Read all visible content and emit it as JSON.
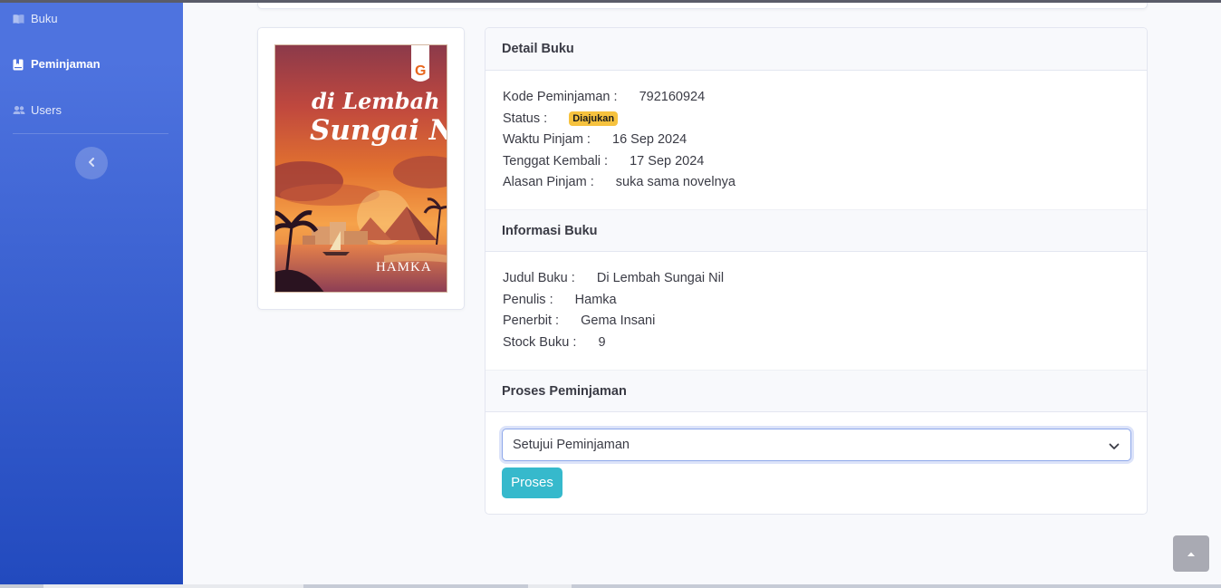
{
  "sidebar": {
    "items": [
      {
        "label": "Buku",
        "icon": "book-icon",
        "active": false
      },
      {
        "label": "Peminjaman",
        "icon": "bookmark-icon",
        "active": true
      },
      {
        "label": "Users",
        "icon": "users-icon",
        "active": false
      }
    ],
    "toggle_icon": "chevron-left-icon"
  },
  "book": {
    "cover": {
      "title_line1": "di Lembah",
      "title_line2": "Sungai Nil",
      "author": "HAMKA",
      "publisher_logo": "G"
    }
  },
  "detail": {
    "header": "Detail Buku",
    "kode_label": "Kode Peminjaman :",
    "kode_value": "792160924",
    "status_label": "Status :",
    "status_value": "Diajukan",
    "waktu_label": "Waktu Pinjam :",
    "waktu_value": "16 Sep 2024",
    "tenggat_label": "Tenggat Kembali :",
    "tenggat_value": "17 Sep 2024",
    "alasan_label": "Alasan Pinjam :",
    "alasan_value": "suka sama novelnya"
  },
  "info": {
    "header": "Informasi Buku",
    "judul_label": "Judul Buku :",
    "judul_value": "Di Lembah Sungai Nil",
    "penulis_label": "Penulis :",
    "penulis_value": "Hamka",
    "penerbit_label": "Penerbit :",
    "penerbit_value": "Gema Insani",
    "stock_label": "Stock Buku :",
    "stock_value": "9"
  },
  "proses": {
    "header": "Proses Peminjaman",
    "selected_option": "Setujui Peminjaman",
    "button_label": "Proses"
  },
  "colors": {
    "sidebar_top": "#4e73df",
    "sidebar_bottom": "#224abe",
    "badge": "#f6c23e",
    "button": "#36b9cc"
  }
}
